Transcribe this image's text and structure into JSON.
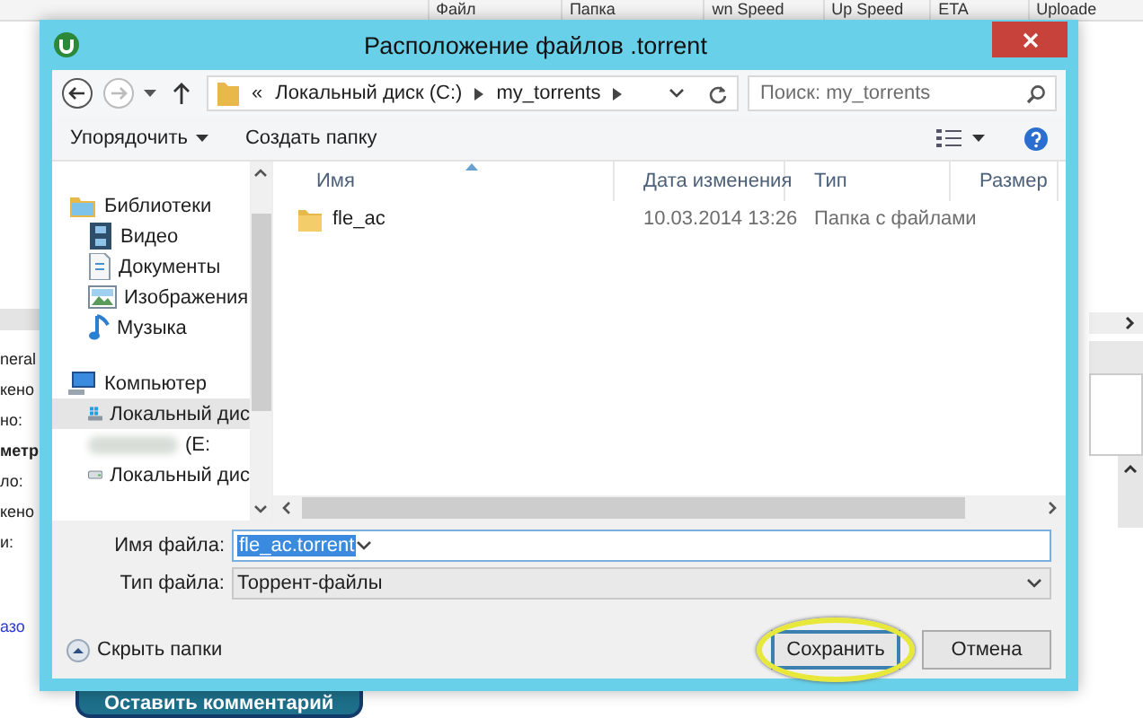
{
  "background_app": {
    "column_headers": [
      "Файл",
      "Папка",
      "wn Speed",
      "Up Speed",
      "ETA",
      "Uploade"
    ],
    "left_fragments": [
      {
        "text": "neral",
        "kind": "plain"
      },
      {
        "text": "кено",
        "kind": "plain"
      },
      {
        "text": "но:",
        "kind": "plain"
      },
      {
        "text": "метр",
        "kind": "bold"
      },
      {
        "text": "ло:",
        "kind": "plain"
      },
      {
        "text": "кено",
        "kind": "plain"
      },
      {
        "text": "и:",
        "kind": "plain"
      },
      {
        "text": "азо",
        "kind": "link"
      }
    ],
    "comment_button": "Оставить комментарий"
  },
  "dialog": {
    "title": "Расположение файлов .torrent",
    "nav": {
      "overflow": "«",
      "path": [
        "Локальный диск (C:)",
        "my_torrents"
      ],
      "search_placeholder": "Поиск: my_torrents"
    },
    "toolbar": {
      "organize": "Упорядочить",
      "new_folder": "Создать папку"
    },
    "sidebar": [
      {
        "label": "Библиотеки",
        "kind": "libraries",
        "selected": false,
        "children": [
          {
            "label": "Видео",
            "kind": "video",
            "selected": false
          },
          {
            "label": "Документы",
            "kind": "documents",
            "selected": false
          },
          {
            "label": "Изображения",
            "kind": "images",
            "selected": false
          },
          {
            "label": "Музыка",
            "kind": "music",
            "selected": false
          }
        ]
      },
      {
        "label": "Компьютер",
        "kind": "computer",
        "selected": false,
        "children": [
          {
            "label": "Локальный дис",
            "kind": "system-drive",
            "selected": true
          },
          {
            "label": "(E:",
            "kind": "blurred-drive",
            "selected": false
          },
          {
            "label": "Локальный дис",
            "kind": "drive",
            "selected": false
          }
        ]
      }
    ],
    "columns": [
      {
        "label": "Имя",
        "sorted": true
      },
      {
        "label": "Дата изменения",
        "sorted": false
      },
      {
        "label": "Тип",
        "sorted": false
      },
      {
        "label": "Размер",
        "sorted": false
      }
    ],
    "files": [
      {
        "name": "fle_ac",
        "date": "10.03.2014 13:26",
        "type": "Папка с файлами"
      }
    ],
    "form": {
      "filename_label": "Имя файла:",
      "filename": "fle_ac.torrent",
      "filename_selected": true,
      "filetype_label": "Тип файла:",
      "filetype": "Торрент-файлы"
    },
    "hide_folders": "Скрыть папки",
    "buttons": [
      {
        "label": "Сохранить",
        "default": true,
        "annotated": true
      },
      {
        "label": "Отмена",
        "default": false,
        "annotated": false
      }
    ]
  }
}
